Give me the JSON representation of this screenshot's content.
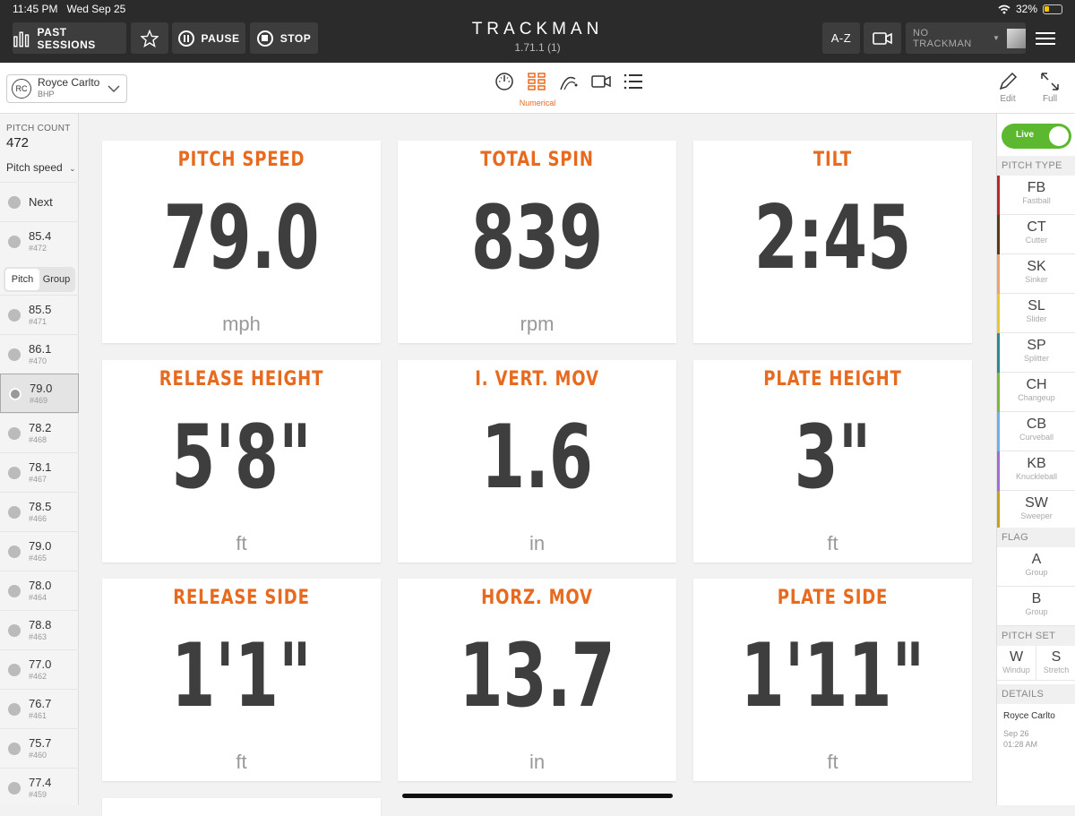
{
  "status": {
    "time": "11:45 PM",
    "date": "Wed Sep 25",
    "battery": "32%"
  },
  "header": {
    "past_sessions": "PAST SESSIONS",
    "pause": "PAUSE",
    "stop": "STOP",
    "brand": "TRACKMAN",
    "version": "1.71.1 (1)",
    "sort": "A-Z",
    "no_trackman": "NO TRACKMAN"
  },
  "toolbar": {
    "player_initials": "RC",
    "player_name": "Royce Carlto",
    "player_team": "BHP",
    "active_view": "Numerical",
    "edit": "Edit",
    "full": "Full"
  },
  "left": {
    "pitch_count_label": "PITCH COUNT",
    "pitch_count": "472",
    "metric": "Pitch speed",
    "next": "Next",
    "latest": {
      "value": "85.4",
      "num": "#472"
    },
    "seg": [
      "Pitch",
      "Group"
    ],
    "pitches": [
      {
        "value": "85.5",
        "num": "#471"
      },
      {
        "value": "86.1",
        "num": "#470"
      },
      {
        "value": "79.0",
        "num": "#469"
      },
      {
        "value": "78.2",
        "num": "#468"
      },
      {
        "value": "78.1",
        "num": "#467"
      },
      {
        "value": "78.5",
        "num": "#466"
      },
      {
        "value": "79.0",
        "num": "#465"
      },
      {
        "value": "78.0",
        "num": "#464"
      },
      {
        "value": "78.8",
        "num": "#463"
      },
      {
        "value": "77.0",
        "num": "#462"
      },
      {
        "value": "76.7",
        "num": "#461"
      },
      {
        "value": "75.7",
        "num": "#460"
      },
      {
        "value": "77.4",
        "num": "#459"
      }
    ]
  },
  "cards": [
    {
      "title": "PITCH SPEED",
      "value": "79.0",
      "unit": "mph"
    },
    {
      "title": "TOTAL SPIN",
      "value": "839",
      "unit": "rpm"
    },
    {
      "title": "TILT",
      "value": "2:45",
      "unit": ""
    },
    {
      "title": "RELEASE HEIGHT",
      "value": "5'8\"",
      "unit": "ft"
    },
    {
      "title": "I. VERT. MOV",
      "value": "1.6",
      "unit": "in"
    },
    {
      "title": "PLATE HEIGHT",
      "value": "3\"",
      "unit": "ft"
    },
    {
      "title": "RELEASE SIDE",
      "value": "1'1\"",
      "unit": "ft"
    },
    {
      "title": "HORZ. MOV",
      "value": "13.7",
      "unit": "in"
    },
    {
      "title": "PLATE SIDE",
      "value": "1'11\"",
      "unit": "ft"
    }
  ],
  "right": {
    "live": "Live",
    "pitch_type_label": "PITCH TYPE",
    "pitch_types": [
      {
        "code": "FB",
        "name": "Fastball",
        "color": "#b52a2a"
      },
      {
        "code": "CT",
        "name": "Cutter",
        "color": "#5a3a1a"
      },
      {
        "code": "SK",
        "name": "Sinker",
        "color": "#f0a070"
      },
      {
        "code": "SL",
        "name": "Slider",
        "color": "#e8c830"
      },
      {
        "code": "SP",
        "name": "Splitter",
        "color": "#2a8a90"
      },
      {
        "code": "CH",
        "name": "Changeup",
        "color": "#7ab83a"
      },
      {
        "code": "CB",
        "name": "Curveball",
        "color": "#70b0e8"
      },
      {
        "code": "KB",
        "name": "Knuckleball",
        "color": "#a070d0"
      },
      {
        "code": "SW",
        "name": "Sweeper",
        "color": "#c8a020"
      }
    ],
    "flag_label": "FLAG",
    "flags": [
      {
        "code": "A",
        "name": "Group"
      },
      {
        "code": "B",
        "name": "Group"
      }
    ],
    "pitch_set_label": "PITCH SET",
    "pitch_set": [
      {
        "code": "W",
        "name": "Windup"
      },
      {
        "code": "S",
        "name": "Stretch"
      }
    ],
    "details_label": "DETAILS",
    "details_name": "Royce Carlto",
    "details_date": "Sep 26",
    "details_time": "01:28 AM"
  }
}
